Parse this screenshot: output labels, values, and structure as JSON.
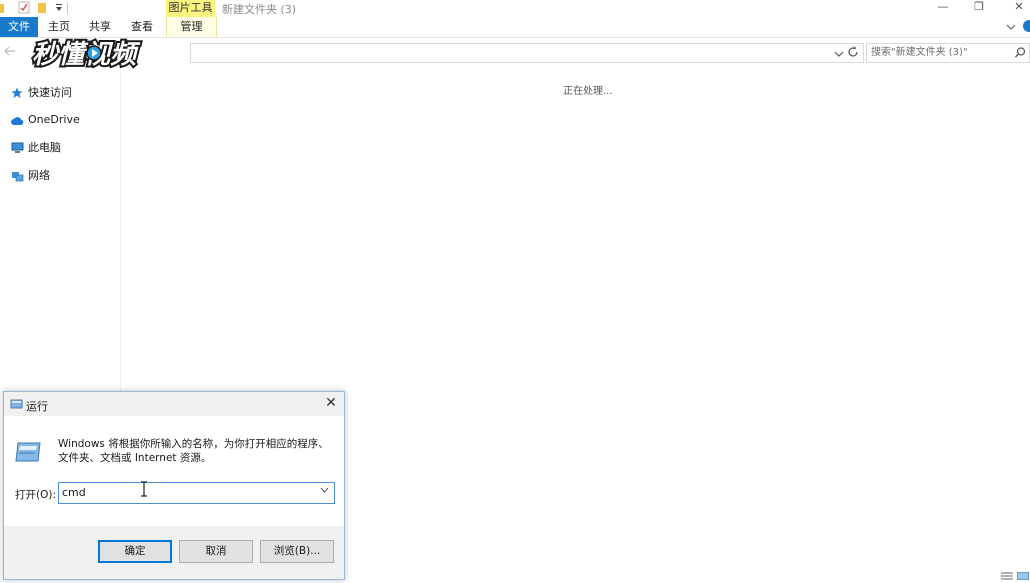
{
  "window": {
    "title": "新建文件夹 (3)",
    "context_tab_label": "图片工具",
    "minimize": "—",
    "restore": "❐",
    "close": "✕"
  },
  "ribbon": {
    "tabs": [
      "文件",
      "主页",
      "共享",
      "查看",
      "管理"
    ]
  },
  "address": {
    "search_placeholder": "搜索\"新建文件夹 (3)\""
  },
  "watermark": {
    "text": "秒懂视频"
  },
  "nav": {
    "items": [
      {
        "label": "快速访问",
        "icon": "star-icon"
      },
      {
        "label": "OneDrive",
        "icon": "cloud-icon"
      },
      {
        "label": "此电脑",
        "icon": "computer-icon"
      },
      {
        "label": "网络",
        "icon": "network-icon"
      }
    ]
  },
  "content": {
    "status": "正在处理..."
  },
  "run_dialog": {
    "title": "运行",
    "description": "Windows 将根据你所输入的名称，为你打开相应的程序、文件夹、文档或 Internet 资源。",
    "open_label": "打开(O):",
    "input_value": "cmd",
    "ok": "确定",
    "cancel": "取消",
    "browse": "浏览(B)..."
  },
  "colors": {
    "accent": "#1979ca",
    "context_tab": "#faf37e",
    "dialog_bg": "#f0f0f0"
  }
}
